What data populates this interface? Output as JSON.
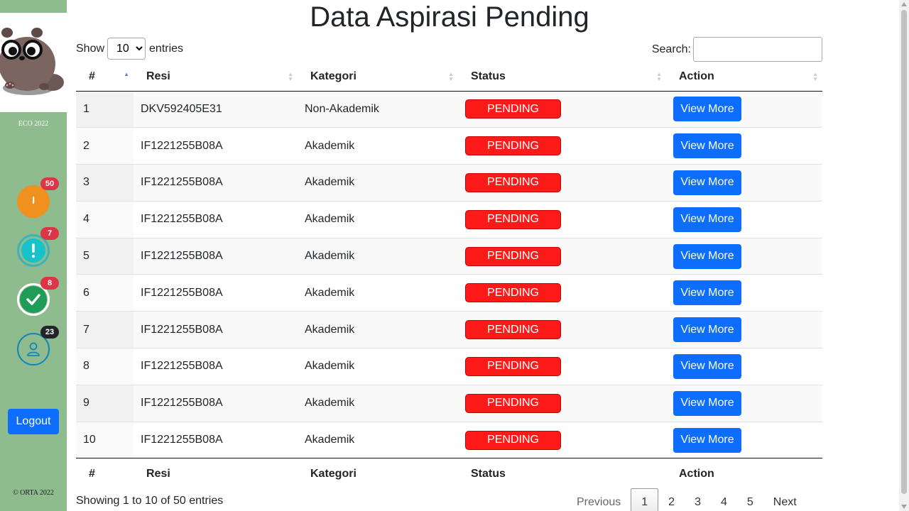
{
  "sidebar": {
    "brand": "ECO 2022",
    "copyright": "© ORTA 2022",
    "logout_label": "Logout",
    "icons": [
      {
        "name": "hourglass-icon",
        "badge": "50",
        "color": "#f0901e"
      },
      {
        "name": "exclamation-icon",
        "badge": "7",
        "color": "#17c2ca"
      },
      {
        "name": "check-icon",
        "badge": "8",
        "color": "#1f9d57"
      },
      {
        "name": "user-icon",
        "badge": "23",
        "color": "#1186b8"
      }
    ]
  },
  "page": {
    "title": "Data Aspirasi Pending"
  },
  "controls": {
    "show_label": "Show",
    "entries_label": "entries",
    "page_length": "10",
    "search_label": "Search:",
    "search_value": ""
  },
  "table": {
    "headers": [
      "#",
      "Resi",
      "Kategori",
      "Status",
      "Action"
    ],
    "rows": [
      {
        "no": "1",
        "resi": "DKV592405E31",
        "kategori": "Non-Akademik",
        "status": "PENDING",
        "action": "View More"
      },
      {
        "no": "2",
        "resi": "IF1221255B08A",
        "kategori": "Akademik",
        "status": "PENDING",
        "action": "View More"
      },
      {
        "no": "3",
        "resi": "IF1221255B08A",
        "kategori": "Akademik",
        "status": "PENDING",
        "action": "View More"
      },
      {
        "no": "4",
        "resi": "IF1221255B08A",
        "kategori": "Akademik",
        "status": "PENDING",
        "action": "View More"
      },
      {
        "no": "5",
        "resi": "IF1221255B08A",
        "kategori": "Akademik",
        "status": "PENDING",
        "action": "View More"
      },
      {
        "no": "6",
        "resi": "IF1221255B08A",
        "kategori": "Akademik",
        "status": "PENDING",
        "action": "View More"
      },
      {
        "no": "7",
        "resi": "IF1221255B08A",
        "kategori": "Akademik",
        "status": "PENDING",
        "action": "View More"
      },
      {
        "no": "8",
        "resi": "IF1221255B08A",
        "kategori": "Akademik",
        "status": "PENDING",
        "action": "View More"
      },
      {
        "no": "9",
        "resi": "IF1221255B08A",
        "kategori": "Akademik",
        "status": "PENDING",
        "action": "View More"
      },
      {
        "no": "10",
        "resi": "IF1221255B08A",
        "kategori": "Akademik",
        "status": "PENDING",
        "action": "View More"
      }
    ]
  },
  "footer": {
    "info": "Showing 1 to 10 of 50 entries",
    "pager": {
      "previous": "Previous",
      "pages": [
        "1",
        "2",
        "3",
        "4",
        "5"
      ],
      "current": "1",
      "next": "Next"
    }
  },
  "colors": {
    "sidebar_bg": "#8fbc8f",
    "primary": "#0d6efd",
    "pending": "#ff1a1a"
  }
}
